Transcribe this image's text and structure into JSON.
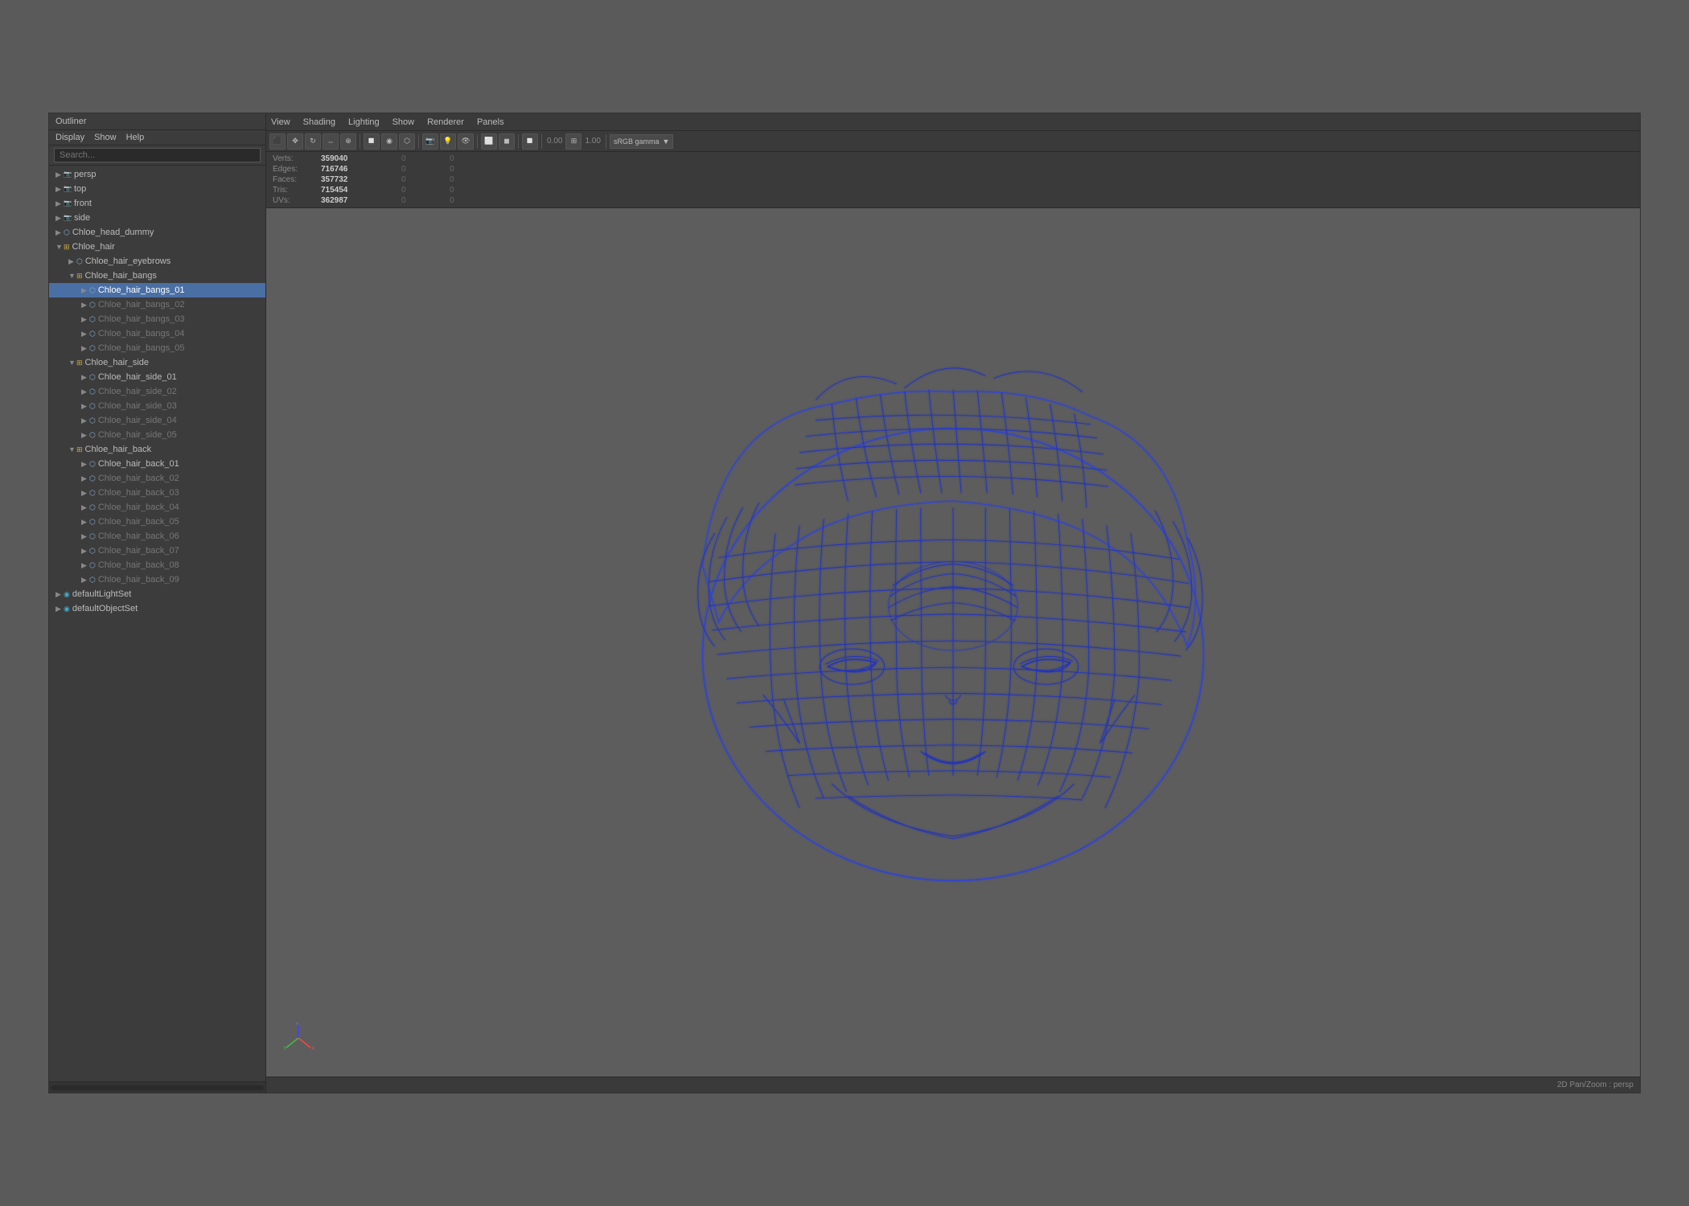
{
  "outliner": {
    "title": "Outliner",
    "menu": {
      "display": "Display",
      "show": "Show",
      "help": "Help"
    },
    "search_placeholder": "Search...",
    "items": [
      {
        "id": "persp",
        "label": "persp",
        "type": "camera",
        "indent": 0,
        "expand": false,
        "visible": true
      },
      {
        "id": "top",
        "label": "top",
        "type": "camera",
        "indent": 0,
        "expand": false,
        "visible": true
      },
      {
        "id": "front",
        "label": "front",
        "type": "camera",
        "indent": 0,
        "expand": false,
        "visible": true
      },
      {
        "id": "side",
        "label": "side",
        "type": "camera",
        "indent": 0,
        "expand": false,
        "visible": true
      },
      {
        "id": "chloe_head_dummy",
        "label": "Chloe_head_dummy",
        "type": "mesh",
        "indent": 0,
        "expand": false,
        "visible": true
      },
      {
        "id": "chloe_hair",
        "label": "Chloe_hair",
        "type": "group",
        "indent": 0,
        "expand": true,
        "visible": true
      },
      {
        "id": "chloe_hair_eyebrows",
        "label": "Chloe_hair_eyebrows",
        "type": "mesh",
        "indent": 1,
        "expand": false,
        "visible": true
      },
      {
        "id": "chloe_hair_bangs",
        "label": "Chloe_hair_bangs",
        "type": "group",
        "indent": 1,
        "expand": true,
        "visible": true
      },
      {
        "id": "chloe_hair_bangs_01",
        "label": "Chloe_hair_bangs_01",
        "type": "mesh",
        "indent": 2,
        "expand": false,
        "visible": true,
        "selected": true
      },
      {
        "id": "chloe_hair_bangs_02",
        "label": "Chloe_hair_bangs_02",
        "type": "mesh",
        "indent": 2,
        "expand": false,
        "visible": true,
        "dimmed": true
      },
      {
        "id": "chloe_hair_bangs_03",
        "label": "Chloe_hair_bangs_03",
        "type": "mesh",
        "indent": 2,
        "expand": false,
        "visible": true,
        "dimmed": true
      },
      {
        "id": "chloe_hair_bangs_04",
        "label": "Chloe_hair_bangs_04",
        "type": "mesh",
        "indent": 2,
        "expand": false,
        "visible": true,
        "dimmed": true
      },
      {
        "id": "chloe_hair_bangs_05",
        "label": "Chloe_hair_bangs_05",
        "type": "mesh",
        "indent": 2,
        "expand": false,
        "visible": true,
        "dimmed": true
      },
      {
        "id": "chloe_hair_side",
        "label": "Chloe_hair_side",
        "type": "group",
        "indent": 1,
        "expand": true,
        "visible": true
      },
      {
        "id": "chloe_hair_side_01",
        "label": "Chloe_hair_side_01",
        "type": "mesh",
        "indent": 2,
        "expand": false,
        "visible": true
      },
      {
        "id": "chloe_hair_side_02",
        "label": "Chloe_hair_side_02",
        "type": "mesh",
        "indent": 2,
        "expand": false,
        "visible": true,
        "dimmed": true
      },
      {
        "id": "chloe_hair_side_03",
        "label": "Chloe_hair_side_03",
        "type": "mesh",
        "indent": 2,
        "expand": false,
        "visible": true,
        "dimmed": true
      },
      {
        "id": "chloe_hair_side_04",
        "label": "Chloe_hair_side_04",
        "type": "mesh",
        "indent": 2,
        "expand": false,
        "visible": true,
        "dimmed": true
      },
      {
        "id": "chloe_hair_side_05",
        "label": "Chloe_hair_side_05",
        "type": "mesh",
        "indent": 2,
        "expand": false,
        "visible": true,
        "dimmed": true
      },
      {
        "id": "chloe_hair_back",
        "label": "Chloe_hair_back",
        "type": "group",
        "indent": 1,
        "expand": true,
        "visible": true
      },
      {
        "id": "chloe_hair_back_01",
        "label": "Chloe_hair_back_01",
        "type": "mesh",
        "indent": 2,
        "expand": false,
        "visible": true
      },
      {
        "id": "chloe_hair_back_02",
        "label": "Chloe_hair_back_02",
        "type": "mesh",
        "indent": 2,
        "expand": false,
        "visible": true,
        "dimmed": true
      },
      {
        "id": "chloe_hair_back_03",
        "label": "Chloe_hair_back_03",
        "type": "mesh",
        "indent": 2,
        "expand": false,
        "visible": true,
        "dimmed": true
      },
      {
        "id": "chloe_hair_back_04",
        "label": "Chloe_hair_back_04",
        "type": "mesh",
        "indent": 2,
        "expand": false,
        "visible": true,
        "dimmed": true
      },
      {
        "id": "chloe_hair_back_05",
        "label": "Chloe_hair_back_05",
        "type": "mesh",
        "indent": 2,
        "expand": false,
        "visible": true,
        "dimmed": true
      },
      {
        "id": "chloe_hair_back_06",
        "label": "Chloe_hair_back_06",
        "type": "mesh",
        "indent": 2,
        "expand": false,
        "visible": true,
        "dimmed": true
      },
      {
        "id": "chloe_hair_back_07",
        "label": "Chloe_hair_back_07",
        "type": "mesh",
        "indent": 2,
        "expand": false,
        "visible": true,
        "dimmed": true
      },
      {
        "id": "chloe_hair_back_08",
        "label": "Chloe_hair_back_08",
        "type": "mesh",
        "indent": 2,
        "expand": false,
        "visible": true,
        "dimmed": true
      },
      {
        "id": "chloe_hair_back_09",
        "label": "Chloe_hair_back_09",
        "type": "mesh",
        "indent": 2,
        "expand": false,
        "visible": true,
        "dimmed": true
      },
      {
        "id": "defaultLightSet",
        "label": "defaultLightSet",
        "type": "set",
        "indent": 0,
        "expand": false,
        "visible": true
      },
      {
        "id": "defaultObjectSet",
        "label": "defaultObjectSet",
        "type": "set",
        "indent": 0,
        "expand": false,
        "visible": true
      }
    ]
  },
  "viewport": {
    "menubar": [
      "View",
      "Shading",
      "Lighting",
      "Show",
      "Renderer",
      "Panels"
    ],
    "stats": {
      "verts_label": "Verts:",
      "verts_val": "359040",
      "verts_sel": "0",
      "verts_total": "0",
      "edges_label": "Edges:",
      "edges_val": "716746",
      "edges_sel": "0",
      "edges_total": "0",
      "faces_label": "Faces:",
      "faces_val": "357732",
      "faces_sel": "0",
      "faces_total": "0",
      "tris_label": "Tris:",
      "tris_val": "715454",
      "tris_sel": "0",
      "tris_total": "0",
      "uvs_label": "UVs:",
      "uvs_val": "362987",
      "uvs_sel": "0",
      "uvs_total": "0"
    },
    "camera_label": "2D Pan/Zoom : persp",
    "gamma_label": "sRGB gamma",
    "gamma_value": "1.00"
  }
}
